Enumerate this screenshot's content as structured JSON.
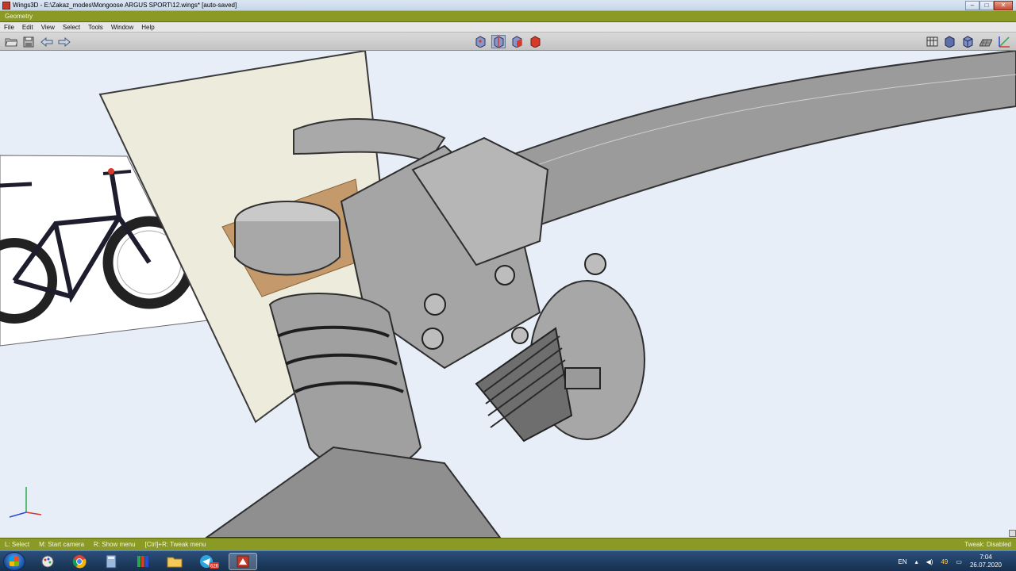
{
  "window": {
    "title": "Wings3D - E:\\Zakaz_modes\\Mongoose ARGUS SPORT\\12.wings* [auto-saved]",
    "minimize_glyph": "–",
    "maximize_glyph": "□",
    "close_glyph": "✕"
  },
  "geometry_bar": {
    "label": "Geometry"
  },
  "menu": {
    "items": [
      "File",
      "Edit",
      "View",
      "Select",
      "Tools",
      "Window",
      "Help"
    ]
  },
  "toolbar": {
    "left_icons": [
      "open-folder-icon",
      "save-icon",
      "undo-arrow-icon",
      "redo-arrow-icon"
    ],
    "mode_icons": [
      "vertex-mode-icon",
      "edge-mode-icon",
      "face-mode-icon",
      "body-mode-icon"
    ],
    "right_icons": [
      "wireframe-toggle-icon",
      "smooth-shaded-icon",
      "flat-shaded-icon",
      "groundplane-icon",
      "axes-icon"
    ],
    "colors": {
      "body_mode": "#d83a2a",
      "mode_blue": "#5c6fa8"
    }
  },
  "viewport": {
    "background": "#e7eef7",
    "axis_colors": {
      "x": "#d83a2a",
      "y": "#2aa84a",
      "z": "#2a4ad8"
    }
  },
  "status": {
    "left_items": [
      "L: Select",
      "M: Start camera",
      "R: Show menu",
      "[Ctrl]+R: Tweak menu"
    ],
    "right": "Tweak: Disabled"
  },
  "taskbar": {
    "apps": [
      "start-icon",
      "paint-icon",
      "chrome-icon",
      "calculator-icon",
      "books-icon",
      "explorer-folder-icon",
      "telegram-icon",
      "wings3d-icon"
    ],
    "telegram_badge": "626",
    "tray": {
      "language": "EN",
      "volume_badge": "49",
      "time": "7:04",
      "date": "26.07.2020"
    }
  }
}
